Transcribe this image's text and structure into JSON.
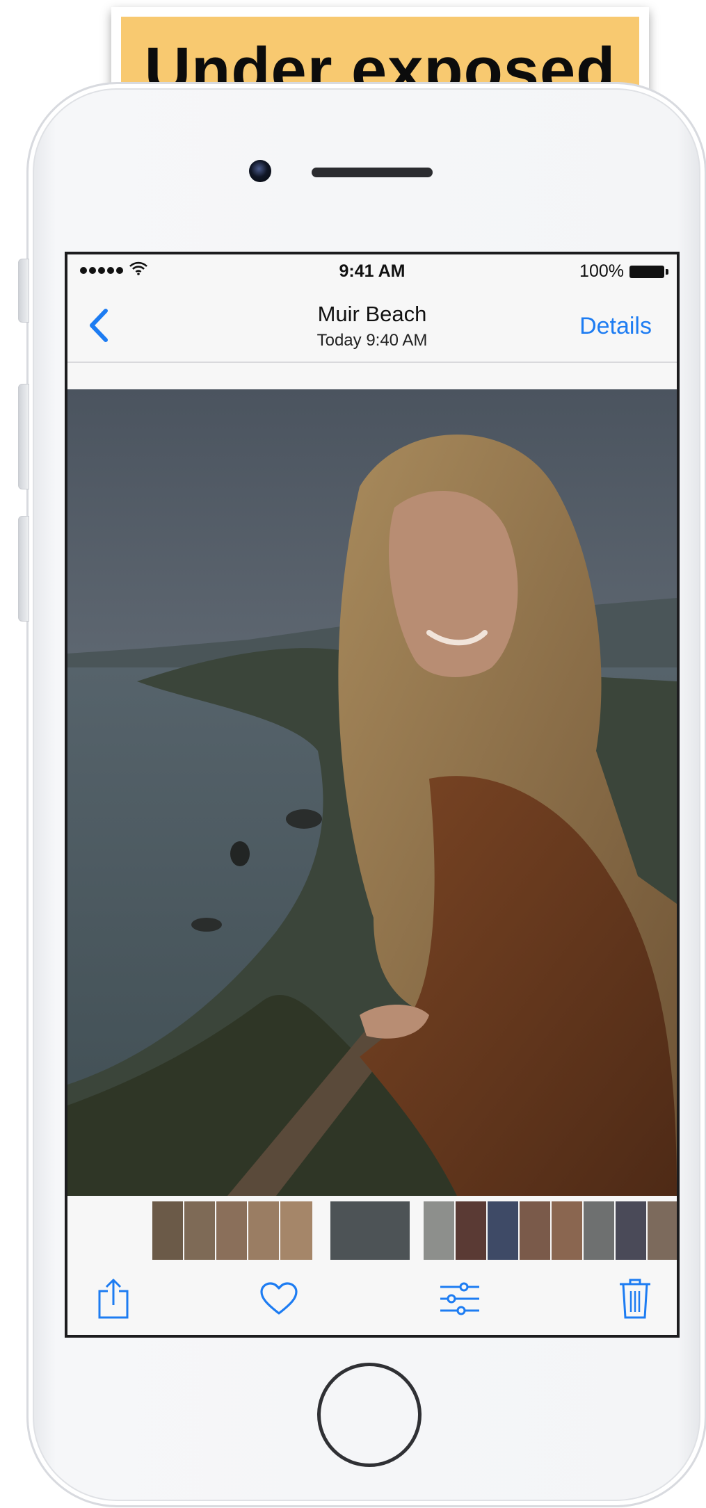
{
  "banner": {
    "label": "Under exposed",
    "color": "#f8c970"
  },
  "status_bar": {
    "time": "9:41 AM",
    "battery": "100%",
    "signal": "•••••"
  },
  "nav": {
    "title": "Muir Beach",
    "subtitle": "Today  9:40  AM",
    "details_label": "Details",
    "back_icon": "chevron-left-icon",
    "accent": "#1d7cf2"
  },
  "photo": {
    "description_icon": "photo"
  },
  "toolbar": {
    "share_icon": "share-icon",
    "favorite_icon": "heart-icon",
    "edit_icon": "sliders-icon",
    "delete_icon": "trash-icon"
  }
}
